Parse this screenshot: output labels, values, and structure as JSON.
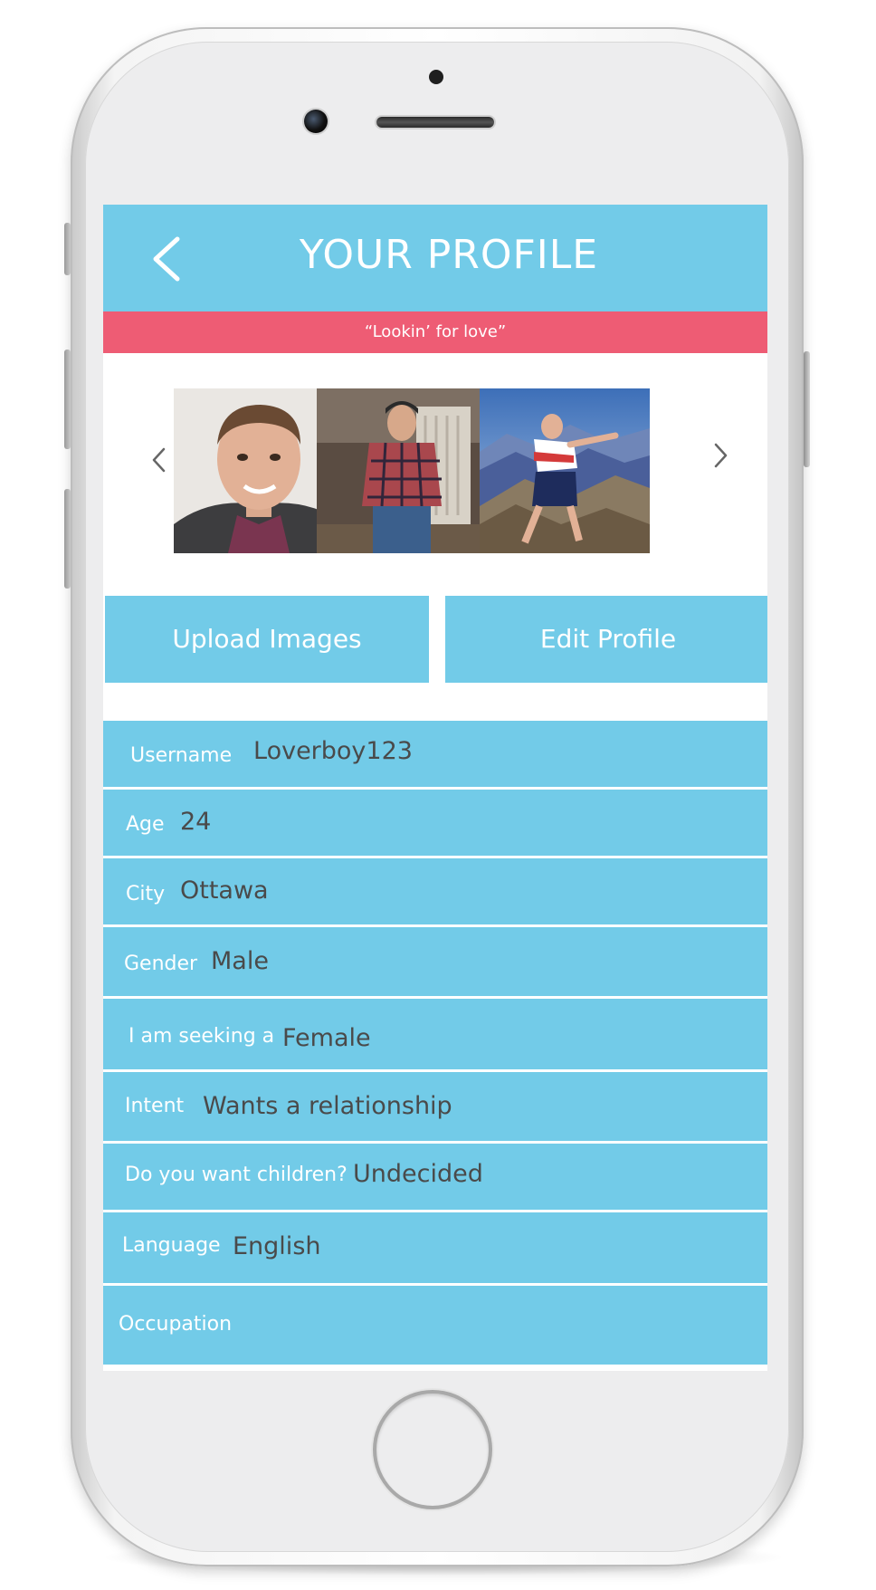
{
  "header": {
    "back_label": "<",
    "title": "YOUR PROFILE"
  },
  "tagline": "“Lookin’ for love”",
  "carousel": {
    "prev_label": "<",
    "next_label": ">",
    "photos": [
      {
        "description": "profile-photo-portrait"
      },
      {
        "description": "profile-photo-full-body"
      },
      {
        "description": "profile-photo-mountain"
      }
    ]
  },
  "actions": {
    "upload_label": "Upload Images",
    "edit_label": "Edit Profile"
  },
  "fields": [
    {
      "label": "Username",
      "value": "Loverboy123"
    },
    {
      "label": "Age",
      "value": "24"
    },
    {
      "label": "City",
      "value": "Ottawa"
    },
    {
      "label": "Gender",
      "value": "Male"
    },
    {
      "label": "I am seeking a",
      "value": "Female"
    },
    {
      "label": "Intent",
      "value": "Wants a relationship"
    },
    {
      "label": "Do you want children?",
      "value": "Undecided"
    },
    {
      "label": "Language",
      "value": "English"
    },
    {
      "label": "Occupation",
      "value": ""
    }
  ],
  "colors": {
    "primary_blue": "#72cbe8",
    "tagline_pink": "#ee5c74",
    "value_text": "#4a4a4a"
  }
}
